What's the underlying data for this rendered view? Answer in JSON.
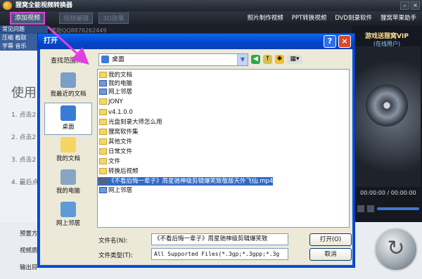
{
  "app": {
    "title": "狸窝全能视频转换器"
  },
  "toolbar": {
    "add_video": "添加视频",
    "btn2": "视频编辑",
    "btn3": "3D效果"
  },
  "top_links": [
    "照片制作视频",
    "PPT转换视频",
    "DVD刻录软件",
    "狸窝苹果助手"
  ],
  "left": {
    "tab": "常见问题",
    "qq": "求助QQ8876262449",
    "row1": "压缩 截取",
    "row2": "字幕 音乐",
    "big": "使用",
    "steps": [
      "1. 点击2",
      "2. 点击2",
      "3. 点击2",
      "4. 最后点"
    ]
  },
  "promo": {
    "line1": "游戏送狸窝VIP",
    "line2": "(在线用户)"
  },
  "player": {
    "time": "00:00:00 / 00:00:00"
  },
  "bottom": {
    "preset": "预置方",
    "quality": "视频质",
    "output": "输出目"
  },
  "dialog": {
    "title": "打开",
    "lookin_label": "查找范围(I):",
    "lookin_value": "桌面",
    "places": [
      "我最近的文档",
      "桌面",
      "我的文档",
      "我的电脑",
      "网上邻居"
    ],
    "files": [
      "我的文档",
      "我的电脑",
      "网上邻居",
      "JONY",
      "v4.1.0.0",
      "光盘刻录大师怎么用",
      "狸窝软件集",
      "其他文件",
      "日常文件",
      "文件",
      "转换后视频",
      "《不看后悔一辈子》周星驰神级剪辑爆笑致敬版天外飞仙.mp4",
      "网上邻居"
    ],
    "filename_label": "文件名(N):",
    "filename_value": "《不看后悔一辈子》周星驰神级剪辑爆笑致",
    "filetype_label": "文件类型(T):",
    "filetype_value": "All Supported Files(*.3gp;*.3gpp;*.3g",
    "open_button": "打开(O)",
    "cancel_button": "取消"
  },
  "colors": {
    "titlebar": "#0b66f0",
    "highlight": "#e040e0",
    "selection": "#316ac5"
  }
}
